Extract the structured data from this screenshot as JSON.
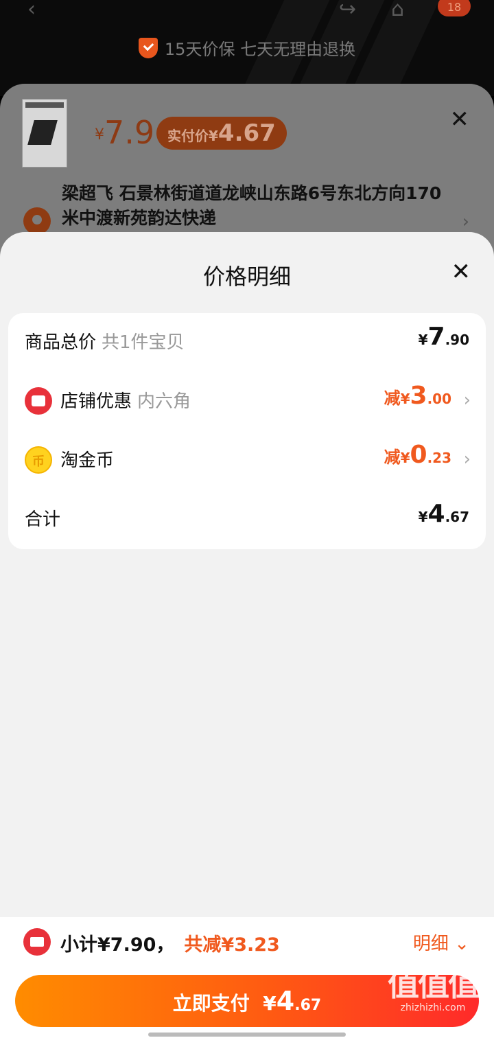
{
  "top": {
    "badge": "18",
    "guarantee_text": "15天价保  七天无理由退换"
  },
  "order_summary": {
    "price_yen": "¥",
    "price": "7.9",
    "paid_label": "实付价",
    "paid_yen": "¥",
    "paid_amount": "4.67",
    "address": "梁超飞  石景林街道道龙峡山东路6号东北方向170米中渡新苑韵达快递"
  },
  "price_detail": {
    "title": "价格明细",
    "rows": [
      {
        "label": "商品总价",
        "sub": "共1件宝贝",
        "prefix": "",
        "currency": "¥",
        "int": "7",
        "dec": ".90"
      },
      {
        "label": "店铺优惠",
        "sub": "内六角",
        "prefix": "减",
        "currency": "¥",
        "int": "3",
        "dec": ".00"
      },
      {
        "label": "淘金币",
        "sub": "",
        "prefix": "减",
        "currency": "¥",
        "int": "0",
        "dec": ".23"
      },
      {
        "label": "合计",
        "sub": "",
        "prefix": "",
        "currency": "¥",
        "int": "4",
        "dec": ".67"
      }
    ]
  },
  "bottom": {
    "subtotal": "小计¥7.90，",
    "saved": "共减¥3.23",
    "detail_link": "明细",
    "pay_label": "立即支付",
    "pay_currency": "¥",
    "pay_int": "4",
    "pay_dec": ".67"
  },
  "watermark": {
    "text": "值值值",
    "url": "zhizhizhi.com"
  },
  "colors": {
    "accent_orange": "#f0591e",
    "shop_red": "#e8313a",
    "coin_gold": "#ffd21f"
  }
}
